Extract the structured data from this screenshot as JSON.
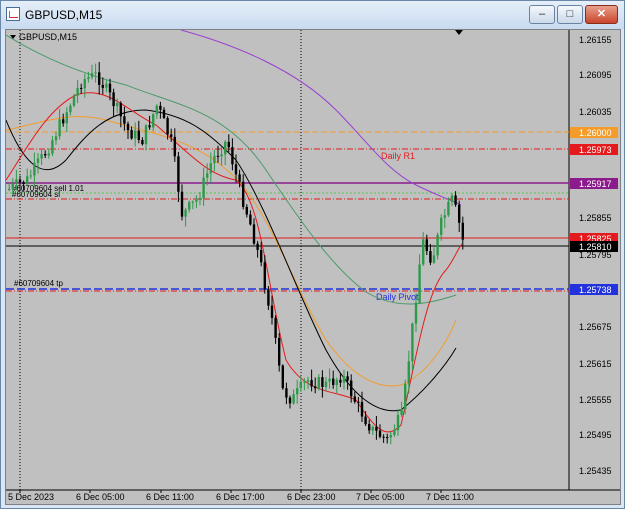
{
  "window": {
    "title": "GBPUSD,M15",
    "min_label": "–",
    "max_label": "□",
    "close_label": "✕"
  },
  "chart": {
    "symbol_label": "GBPUSD,M15",
    "price_ticks": [
      "1.26155",
      "1.26095",
      "1.26035",
      "1.25975",
      "1.25915",
      "1.25855",
      "1.25795",
      "1.25735",
      "1.25675",
      "1.25615",
      "1.25555",
      "1.25495",
      "1.25435"
    ],
    "time_ticks": [
      "5 Dec 2023",
      "6 Dec 05:00",
      "6 Dec 11:00",
      "6 Dec 17:00",
      "6 Dec 23:00",
      "7 Dec 05:00",
      "7 Dec 11:00"
    ],
    "lines": {
      "level_26000": "1.26000",
      "daily_r1": {
        "label": "Daily R1",
        "price": "1.25973"
      },
      "current": "1.25917",
      "bid_red": "1.25825",
      "ask_black": "1.25810",
      "daily_pivot": {
        "label": "Daily Pivot",
        "price": "1.25738"
      }
    },
    "order_labels": {
      "sell": "#60709604 sell 1.01",
      "sl": "#60709604 sl",
      "tp": "#60709604 tp"
    },
    "colors": {
      "background": "#c0c0c0",
      "bull_candle": "#2d9a4a",
      "bear_candle": "#000000",
      "ma_fast": "#e41a1c",
      "ma_orange": "#f39c2b",
      "ma_green": "#4a9a6a",
      "ma_black": "#000000",
      "ma_purple": "#9b3fcf",
      "pivot_blue": "#2233dd"
    }
  }
}
